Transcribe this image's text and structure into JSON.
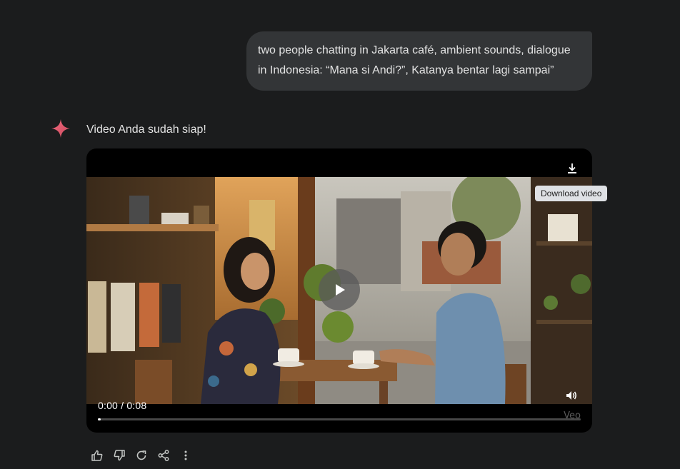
{
  "conversation": {
    "user_prompt": "two people chatting in Jakarta café, ambient sounds, dialogue in Indonesia: “Mana si Andi?”, Katanya bentar lagi sampai”",
    "response_text": "Video Anda sudah siap!"
  },
  "video": {
    "time_display": "0:00 / 0:08",
    "progress": 0.0,
    "watermark": "Veo",
    "download_tooltip": "Download video"
  },
  "icons": {
    "sparkle": "gemini-sparkle-icon",
    "play": "play-icon",
    "download": "download-icon",
    "volume": "volume-icon",
    "actions": [
      "thumbs-up-icon",
      "thumbs-down-icon",
      "regenerate-icon",
      "share-icon",
      "more-vert-icon"
    ]
  },
  "colors": {
    "background": "#1b1c1d",
    "bubble": "#333537",
    "sparkle_start": "#f05a6e",
    "sparkle_end": "#c5485a"
  }
}
